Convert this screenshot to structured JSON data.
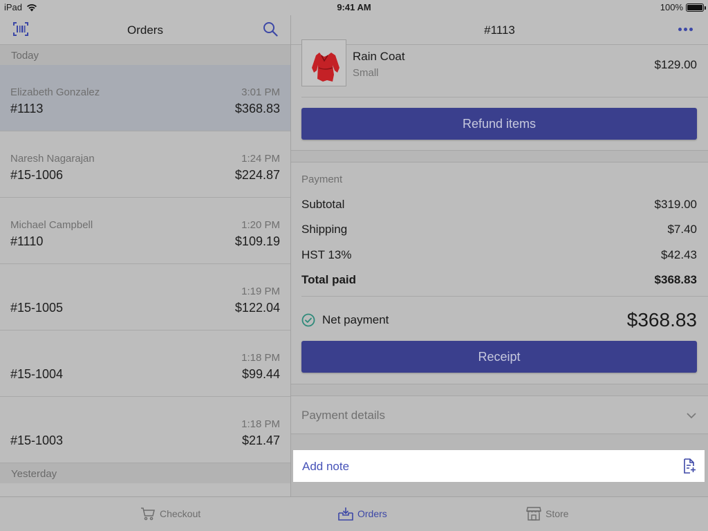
{
  "status": {
    "device": "iPad",
    "time": "9:41 AM",
    "battery": "100%"
  },
  "left": {
    "title": "Orders",
    "sections": {
      "today": "Today",
      "yesterday": "Yesterday"
    },
    "orders": [
      {
        "customer": "Elizabeth Gonzalez",
        "time": "3:01 PM",
        "number": "#1113",
        "amount": "$368.83",
        "selected": true
      },
      {
        "customer": "Naresh Nagarajan",
        "time": "1:24 PM",
        "number": "#15-1006",
        "amount": "$224.87"
      },
      {
        "customer": "Michael Campbell",
        "time": "1:20 PM",
        "number": "#1110",
        "amount": "$109.19"
      },
      {
        "customer": "",
        "time": "1:19 PM",
        "number": "#15-1005",
        "amount": "$122.04"
      },
      {
        "customer": "",
        "time": "1:18 PM",
        "number": "#15-1004",
        "amount": "$99.44"
      },
      {
        "customer": "",
        "time": "1:18 PM",
        "number": "#15-1003",
        "amount": "$21.47"
      }
    ]
  },
  "right": {
    "title": "#1113",
    "item": {
      "name": "Rain Coat",
      "variant": "Small",
      "price": "$129.00"
    },
    "refund_label": "Refund items",
    "payment": {
      "title": "Payment",
      "rows": [
        {
          "label": "Subtotal",
          "value": "$319.00"
        },
        {
          "label": "Shipping",
          "value": "$7.40"
        },
        {
          "label": "HST 13%",
          "value": "$42.43"
        },
        {
          "label": "Total paid",
          "value": "$368.83"
        }
      ],
      "net_label": "Net payment",
      "net_amount": "$368.83",
      "receipt_label": "Receipt"
    },
    "details_label": "Payment details",
    "note_label": "Add note"
  },
  "tabs": [
    {
      "label": "Checkout",
      "icon": "cart-icon"
    },
    {
      "label": "Orders",
      "icon": "orders-inbox-icon",
      "active": true
    },
    {
      "label": "Store",
      "icon": "store-icon"
    }
  ],
  "colors": {
    "accent": "#3c47a6",
    "button": "#3a3f8d",
    "success": "#2e8a7a"
  }
}
